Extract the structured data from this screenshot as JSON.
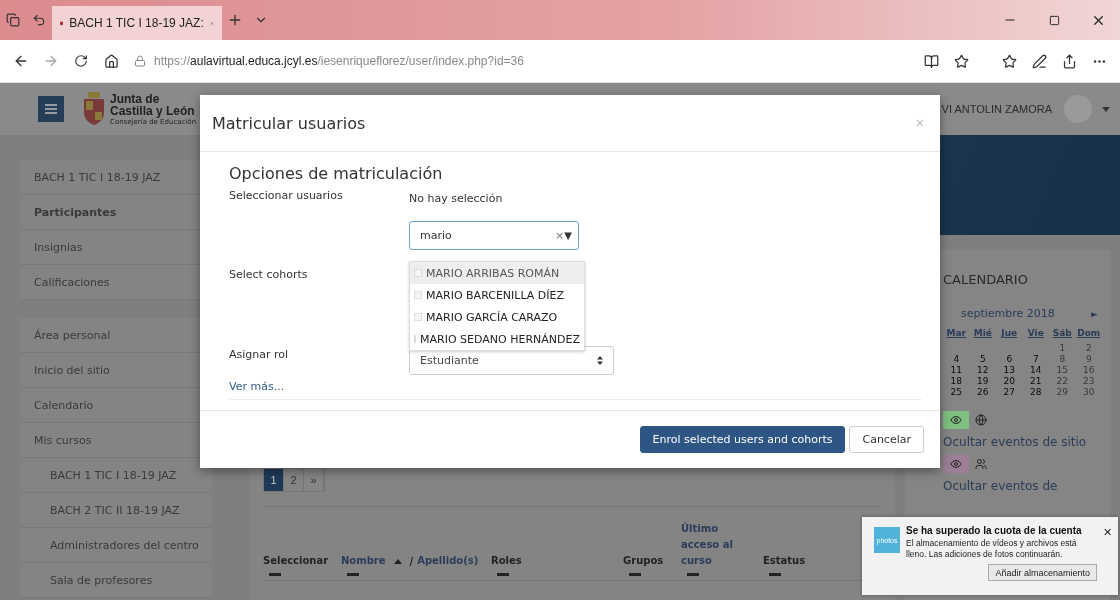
{
  "browser": {
    "tab_title": "BACH 1 TIC I 18-19 JAZ:",
    "url": {
      "scheme": "https://",
      "host": "aulavirtual.educa.jcyl.es",
      "path": "/iesenriqueflorez/user/index.php?id=36"
    }
  },
  "header": {
    "logo": {
      "line1": "Junta de",
      "line2": "Castilla y León",
      "line3": "Consejería de Educación"
    },
    "user_name": "VI ANTOLIN ZAMORA"
  },
  "sidebar": {
    "groups": [
      {
        "items": [
          {
            "label": "BACH 1 TIC I 18-19 JAZ",
            "selected": false
          },
          {
            "label": "Participantes",
            "selected": true
          },
          {
            "label": "Insignias",
            "selected": false
          },
          {
            "label": "Calificaciones",
            "selected": false
          }
        ]
      },
      {
        "items": [
          {
            "label": "Área personal",
            "selected": false
          },
          {
            "label": "Inicio del sitio",
            "selected": false
          },
          {
            "label": "Calendario",
            "selected": false
          },
          {
            "label": "Mis cursos",
            "selected": false,
            "children": [
              {
                "label": "BACH 1 TIC I 18-19 JAZ",
                "selected": false
              },
              {
                "label": "BACH 2 TIC II 18-19 JAZ",
                "selected": false
              },
              {
                "label": "Administradores del centro",
                "selected": false
              },
              {
                "label": "Sala de profesores",
                "selected": false
              }
            ]
          }
        ]
      }
    ]
  },
  "pagination": {
    "pages": [
      {
        "label": "1",
        "selected": true
      },
      {
        "label": "2",
        "selected": false
      }
    ],
    "next": "»"
  },
  "table": {
    "columns": [
      {
        "kind": "plain",
        "label": "Seleccionar"
      },
      {
        "kind": "name",
        "first": "Nombre",
        "separator": "/",
        "last": "Apellido(s)"
      },
      {
        "kind": "plain",
        "label": "Roles"
      },
      {
        "kind": "plain",
        "label": "Grupos"
      },
      {
        "kind": "link",
        "label": "Último acceso al curso"
      },
      {
        "kind": "plain",
        "label": "Estatus"
      }
    ]
  },
  "calendar": {
    "title": "CALENDARIO",
    "month": "septiembre 2018",
    "next": "►",
    "weekdays": [
      "Mar",
      "Mié",
      "Jue",
      "Vie",
      "Sáb",
      "Dom"
    ],
    "weeks": [
      [
        {
          "day": "1",
          "weekend": true
        },
        {
          "day": "2",
          "weekend": true
        }
      ],
      [
        {
          "day": "4",
          "weekend": false
        },
        {
          "day": "5",
          "weekend": false
        },
        {
          "day": "6",
          "weekend": false
        },
        {
          "day": "7",
          "weekend": false
        },
        {
          "day": "8",
          "weekend": true
        },
        {
          "day": "9",
          "weekend": true
        }
      ],
      [
        {
          "day": "11",
          "weekend": false
        },
        {
          "day": "12",
          "weekend": false
        },
        {
          "day": "13",
          "weekend": false
        },
        {
          "day": "14",
          "weekend": false
        },
        {
          "day": "15",
          "weekend": true
        },
        {
          "day": "16",
          "weekend": true
        }
      ],
      [
        {
          "day": "18",
          "weekend": false
        },
        {
          "day": "19",
          "weekend": false
        },
        {
          "day": "20",
          "weekend": false
        },
        {
          "day": "21",
          "weekend": false
        },
        {
          "day": "22",
          "weekend": true
        },
        {
          "day": "23",
          "weekend": true
        }
      ],
      [
        {
          "day": "25",
          "weekend": false
        },
        {
          "day": "26",
          "weekend": false
        },
        {
          "day": "27",
          "weekend": false
        },
        {
          "day": "28",
          "weekend": false
        },
        {
          "day": "29",
          "weekend": true
        },
        {
          "day": "30",
          "weekend": true
        }
      ]
    ],
    "filters": [
      {
        "kind": "site",
        "label": "Ocultar eventos de sitio",
        "color": "#7fbf7f"
      },
      {
        "kind": "group",
        "label": "Ocultar eventos de",
        "color": "#9a7f96"
      }
    ]
  },
  "modal": {
    "title": "Matricular usuarios",
    "close": "×",
    "section": "Opciones de matriculación",
    "users_label": "Seleccionar usuarios",
    "no_selection": "No hay selección",
    "search_value": "mario",
    "clear": "×",
    "arrow": "▼",
    "suggestions": [
      {
        "label": "MARIO ARRIBAS ROMÁN",
        "selected": true
      },
      {
        "label": "MARIO BARCENILLA DÍEZ",
        "selected": false
      },
      {
        "label": "MARIO GARCÍA CARAZO",
        "selected": false
      },
      {
        "label": "MARIO SEDANO HERNÁNDEZ",
        "selected": false
      }
    ],
    "cohorts_label": "Select cohorts",
    "role_label": "Asignar rol",
    "role_value": "Estudiante",
    "more_link": "Ver más...",
    "buttons": [
      {
        "kind": "primary",
        "label": "Enrol selected users and cohorts"
      },
      {
        "kind": "secondary",
        "label": "Cancelar"
      }
    ]
  },
  "toast": {
    "logo_text": "photos",
    "title": "Se ha superado la cuota de la cuenta",
    "message": "El almacenamiento de vídeos y archivos está lleno. Las adiciones de fotos continuarán.",
    "button": "Añadir almacenamiento",
    "close": "✕"
  }
}
